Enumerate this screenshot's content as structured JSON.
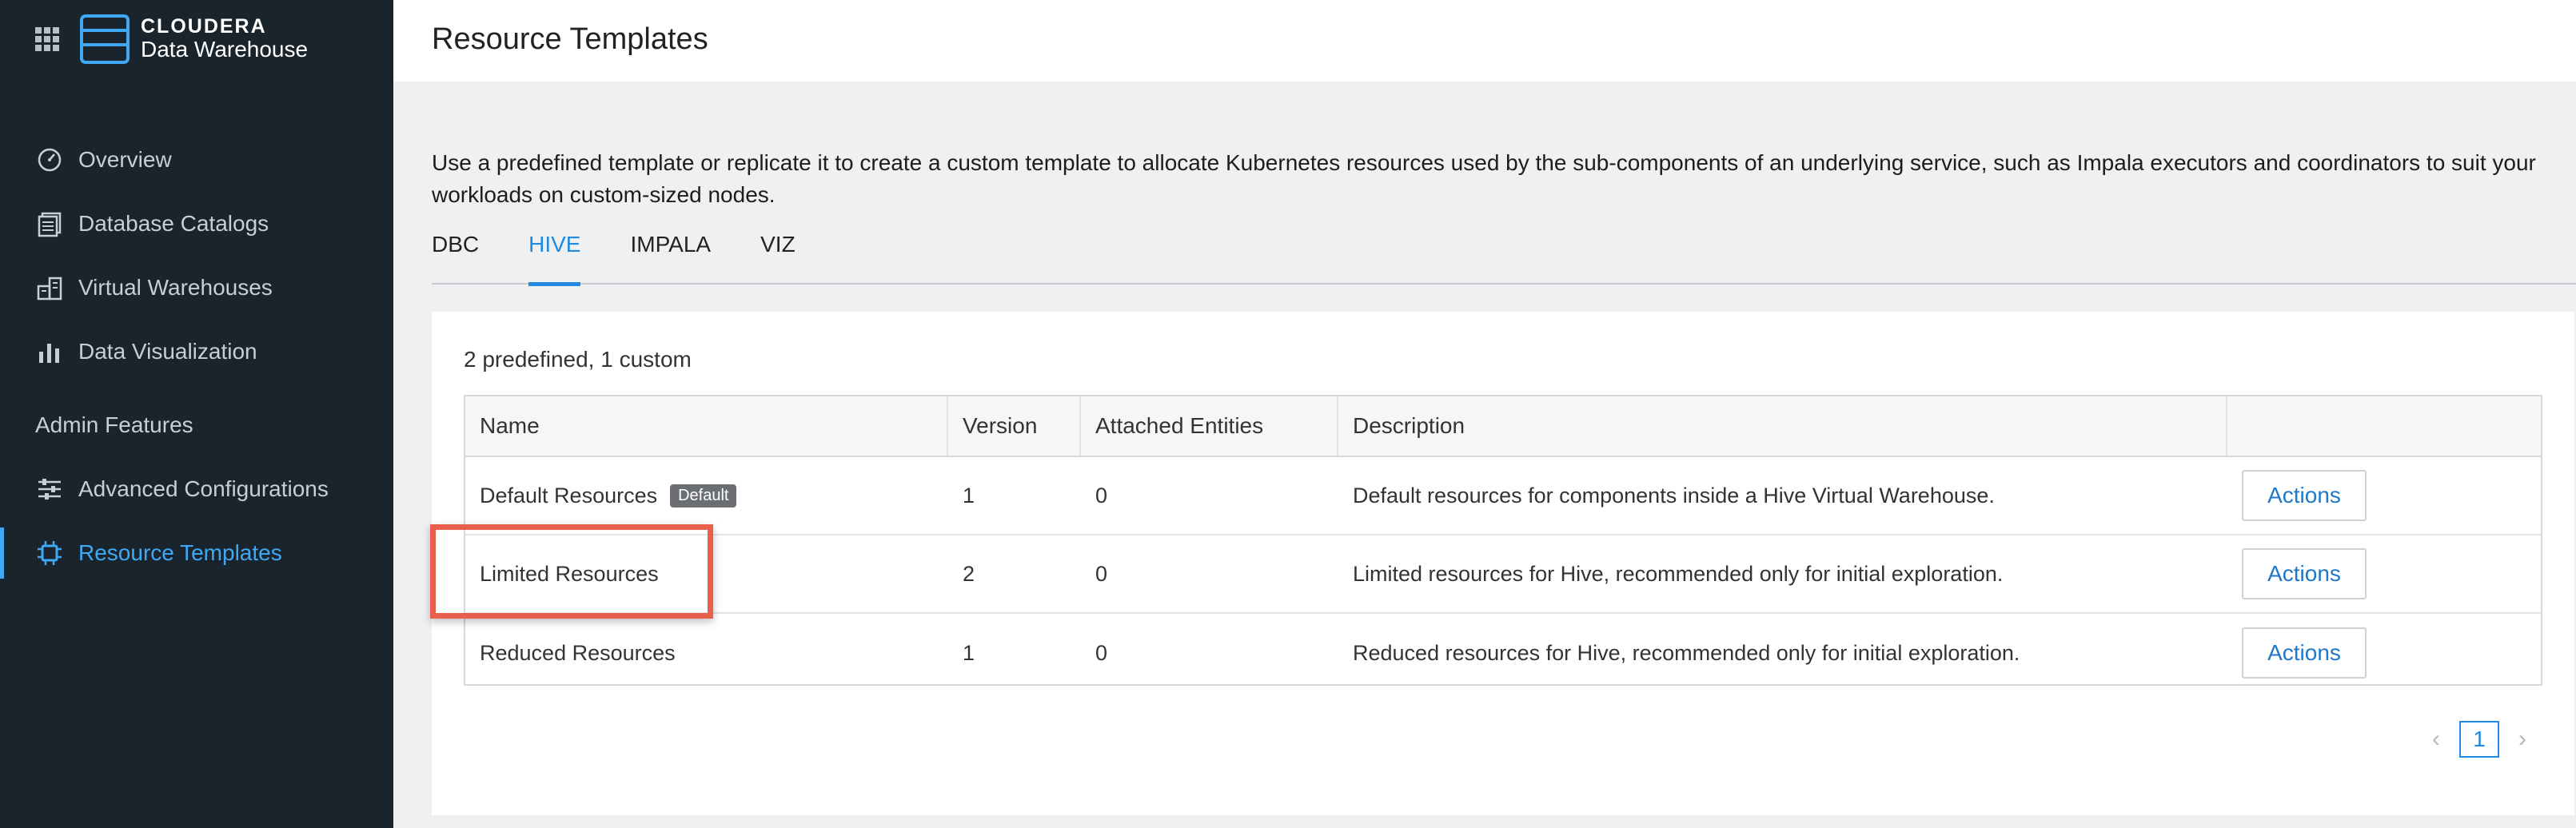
{
  "brand": {
    "company": "CLOUDERA",
    "product": "Data Warehouse"
  },
  "sidebar": {
    "items": [
      {
        "label": "Overview",
        "icon": "gauge-icon"
      },
      {
        "label": "Database Catalogs",
        "icon": "database-catalog-icon"
      },
      {
        "label": "Virtual Warehouses",
        "icon": "warehouse-icon"
      },
      {
        "label": "Data Visualization",
        "icon": "bar-chart-icon"
      }
    ],
    "section_label": "Admin Features",
    "admin_items": [
      {
        "label": "Advanced Configurations",
        "icon": "sliders-icon"
      },
      {
        "label": "Resource Templates",
        "icon": "chip-icon",
        "active": true
      }
    ]
  },
  "page": {
    "title": "Resource Templates",
    "intro": "Use a predefined template or replicate it to create a custom template to allocate Kubernetes resources used by the sub-components of an underlying service, such as Impala executors and coordinators to suit your workloads on custom-sized nodes."
  },
  "tabs": [
    {
      "label": "DBC",
      "active": false
    },
    {
      "label": "HIVE",
      "active": true
    },
    {
      "label": "IMPALA",
      "active": false
    },
    {
      "label": "VIZ",
      "active": false
    }
  ],
  "table": {
    "summary": "2 predefined, 1 custom",
    "headers": {
      "name": "Name",
      "version": "Version",
      "entities": "Attached Entities",
      "description": "Description",
      "actions": ""
    },
    "rows": [
      {
        "name": "Default Resources",
        "badge": "Default",
        "version": "1",
        "entities": "0",
        "description": "Default resources for components inside a Hive Virtual Warehouse.",
        "action": "Actions"
      },
      {
        "name": "Limited Resources",
        "badge": "",
        "version": "2",
        "entities": "0",
        "description": "Limited resources for Hive, recommended only for initial exploration.",
        "action": "Actions"
      },
      {
        "name": "Reduced Resources",
        "badge": "",
        "version": "1",
        "entities": "0",
        "description": "Reduced resources for Hive, recommended only for initial exploration.",
        "action": "Actions"
      }
    ]
  },
  "pagination": {
    "current_page": "1",
    "prev_icon": "chevron-left-icon",
    "next_icon": "chevron-right-icon"
  },
  "colors": {
    "sidebar_bg": "#19242c",
    "accent": "#1f8ae0",
    "highlight": "#e8604c"
  }
}
